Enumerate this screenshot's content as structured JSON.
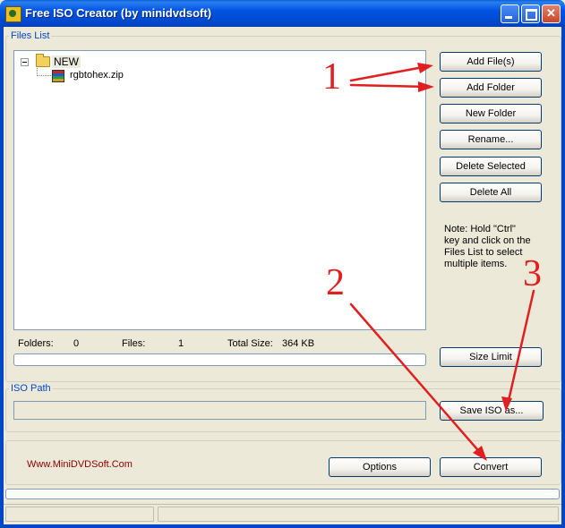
{
  "window": {
    "title": "Free ISO Creator (by minidvdsoft)",
    "controls": {
      "minimize": "minimize",
      "maximize": "maximize",
      "close": "close"
    }
  },
  "files_list": {
    "legend": "Files List",
    "tree": [
      {
        "label": "NEW",
        "icon": "folder-icon",
        "expanded": true,
        "children": [
          {
            "label": "rgbtohex.zip",
            "icon": "zip-archive-icon"
          }
        ]
      }
    ]
  },
  "buttons": {
    "add_files": "Add File(s)",
    "add_folder": "Add Folder",
    "new_folder": "New Folder",
    "rename": "Rename...",
    "delete_selected": "Delete Selected",
    "delete_all": "Delete All",
    "size_limit": "Size Limit",
    "save_iso_as": "Save ISO as...",
    "options": "Options",
    "convert": "Convert"
  },
  "note": "Note: Hold \"Ctrl\" key and click on the Files List to select multiple items.",
  "stats": {
    "folders_label": "Folders:",
    "folders_value": "0",
    "files_label": "Files:",
    "files_value": "1",
    "total_size_label": "Total Size:",
    "total_size_value": "364 KB"
  },
  "iso_path": {
    "legend": "ISO Path",
    "value": ""
  },
  "footer": {
    "website": "Www.MiniDVDSoft.Com"
  },
  "annotations": {
    "numbers": [
      "1",
      "2",
      "3"
    ],
    "color": "#e02020"
  },
  "colors": {
    "titlebar": "#0054e3",
    "window_bg": "#ece9d8",
    "legend_text": "#0046d5",
    "website_text": "#8b0000"
  }
}
